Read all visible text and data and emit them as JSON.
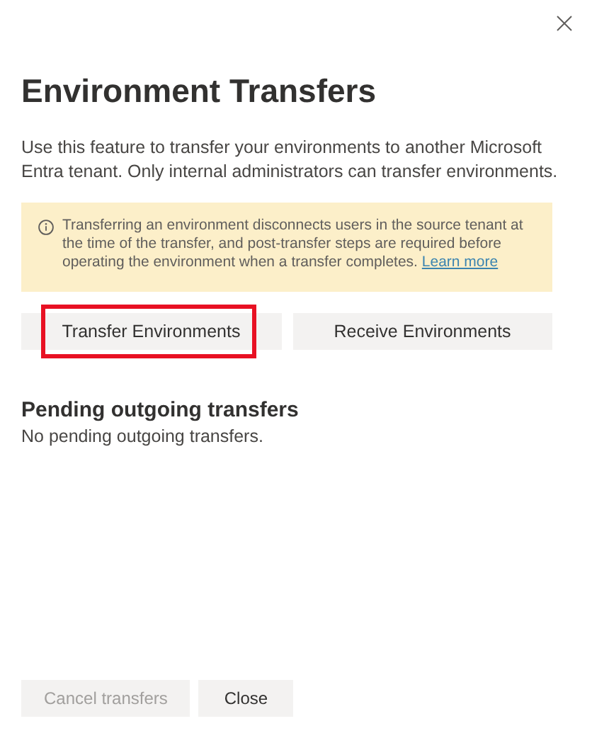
{
  "title": "Environment Transfers",
  "description": "Use this feature to transfer your environments to another Microsoft Entra tenant. Only internal administrators can transfer environments.",
  "notice": {
    "text": "Transferring an environment disconnects users in the source tenant at the time of the transfer, and post-transfer steps are required before operating the environment when a transfer completes.",
    "link": "Learn more"
  },
  "actions": [
    {
      "label": "Transfer Environments",
      "highlighted": true
    },
    {
      "label": "Receive Environments",
      "highlighted": false
    }
  ],
  "section": {
    "heading": "Pending outgoing transfers",
    "empty_text": "No pending outgoing transfers."
  },
  "footer_buttons": [
    {
      "label": "Cancel transfers",
      "disabled": true
    },
    {
      "label": "Close",
      "disabled": false
    }
  ]
}
